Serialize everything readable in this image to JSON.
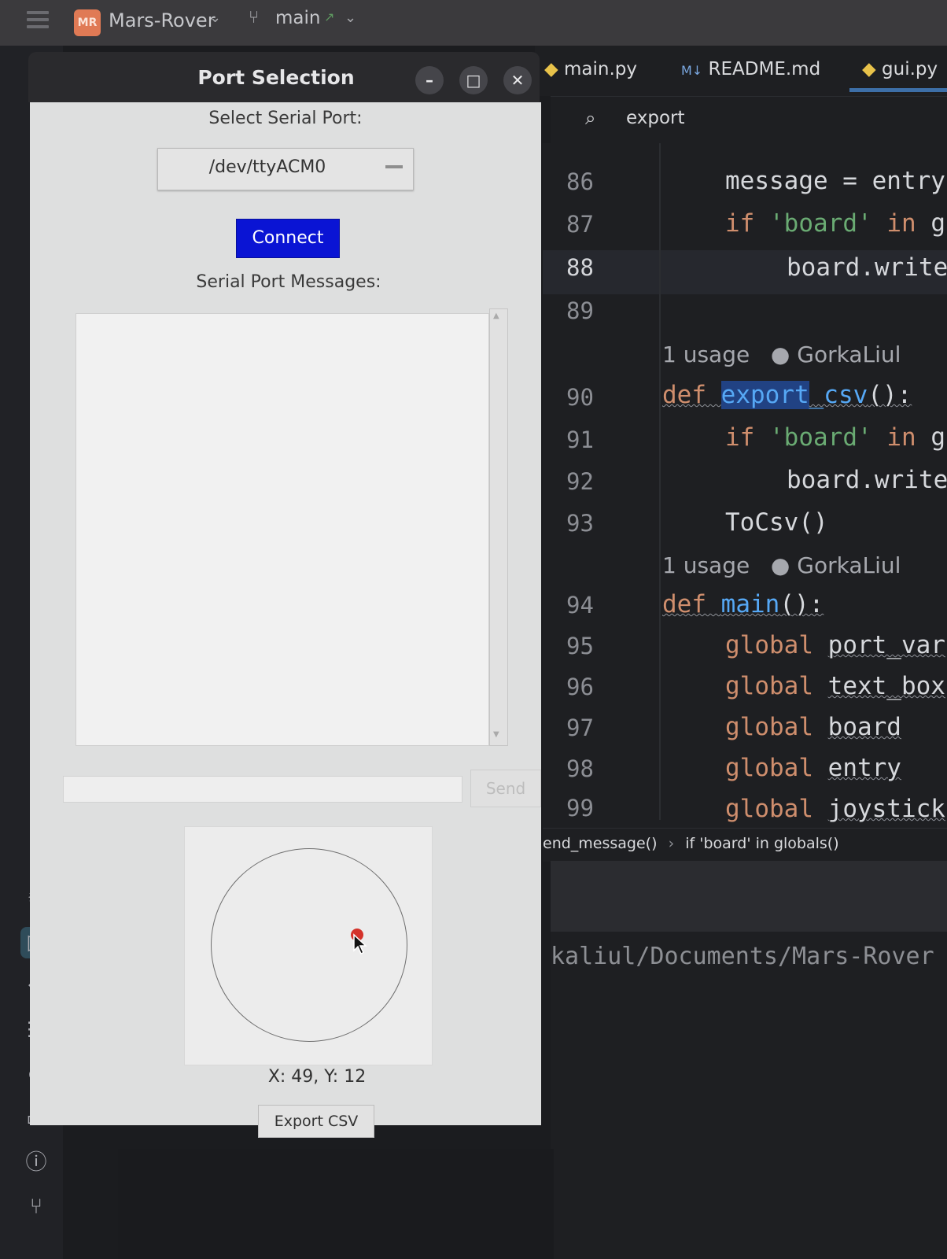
{
  "ide": {
    "project_badge": "MR",
    "project_name": "Mars-Rover",
    "branch": "main",
    "tabs": [
      {
        "icon": "python-file-icon",
        "label": "main.py"
      },
      {
        "icon": "markdown-file-icon",
        "prefix": "M↓",
        "label": "README.md"
      },
      {
        "icon": "python-file-icon",
        "label": "gui.py"
      }
    ],
    "search_query": "export",
    "line_numbers": [
      "86",
      "87",
      "88",
      "89",
      "90",
      "91",
      "92",
      "93",
      "94",
      "95",
      "96",
      "97",
      "98",
      "99"
    ],
    "current_line": "88",
    "usage_hints": [
      {
        "usage": "1 usage",
        "author": "GorkaLiul"
      },
      {
        "usage": "1 usage",
        "author": "GorkaLiul"
      }
    ],
    "breadcrumb": [
      "end_message()",
      "if 'board' in globals()"
    ],
    "terminal_text": "kaliul/Documents/Mars-Rover"
  },
  "code": {
    "l86": {
      "a": "message = ",
      "b": "entry"
    },
    "l87": {
      "kw1": "if ",
      "str": "'board'",
      "kw2": " in ",
      "rest": "g"
    },
    "l88": "board.write",
    "l90": {
      "kw": "def ",
      "name_hl": "export",
      "name_rest": "_csv",
      "tail": "():"
    },
    "l91": {
      "kw1": "if ",
      "str": "'board'",
      "kw2": " in ",
      "rest": "g"
    },
    "l92": "board.write",
    "l93": "ToCsv()",
    "l94": {
      "kw": "def ",
      "name": "main",
      "tail": "():"
    },
    "l95": {
      "kw": "global ",
      "var": "port_var"
    },
    "l96": {
      "kw": "global ",
      "var": "text_box"
    },
    "l97": {
      "kw": "global ",
      "var": "board"
    },
    "l98": {
      "kw": "global ",
      "var": "entry"
    },
    "l99": {
      "kw": "global ",
      "var": "joystick"
    }
  },
  "window": {
    "title": "Port Selection",
    "select_label": "Select Serial Port:",
    "port_value": "/dev/ttyACM0",
    "connect_label": "Connect",
    "messages_label": "Serial Port Messages:",
    "send_label": "Send",
    "coords": "X: 49, Y: 12",
    "export_label": "Export CSV"
  },
  "colors": {
    "connect_button": "#0a14d4",
    "joystick_dot": "#d4322a",
    "keyword": "#cf8e6d",
    "string": "#6aab73",
    "function": "#56a8f5"
  }
}
